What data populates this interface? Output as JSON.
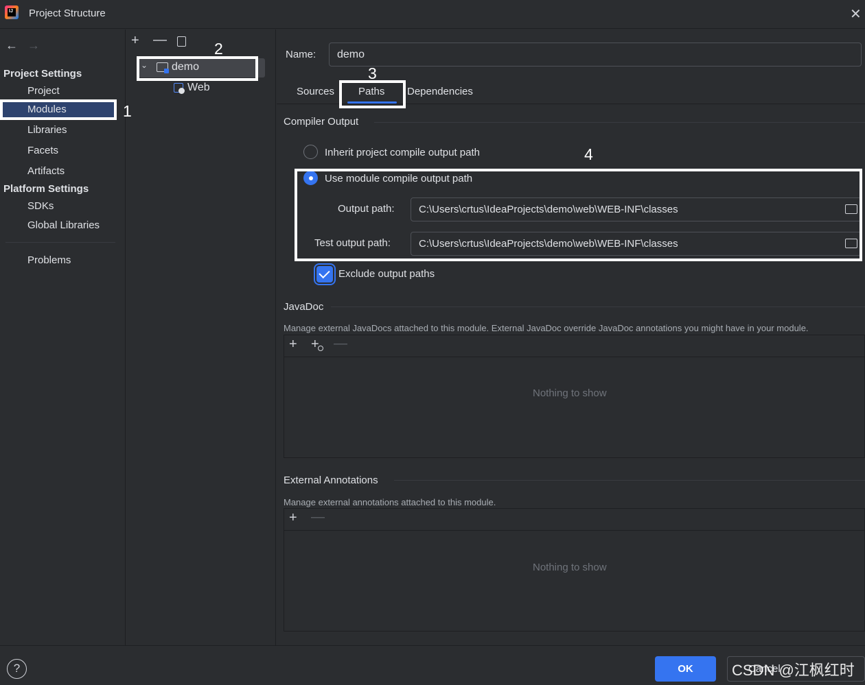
{
  "window": {
    "title": "Project Structure"
  },
  "sidebar": {
    "project_settings_header": "Project Settings",
    "items_project": [
      "Project",
      "Modules",
      "Libraries",
      "Facets",
      "Artifacts"
    ],
    "platform_settings_header": "Platform Settings",
    "items_platform": [
      "SDKs",
      "Global Libraries"
    ],
    "problems": "Problems",
    "selected": "Modules"
  },
  "tree": {
    "root": "demo",
    "child": "Web"
  },
  "module": {
    "name_label": "Name:",
    "name_value": "demo",
    "tabs": [
      "Sources",
      "Paths",
      "Dependencies"
    ],
    "active_tab": "Paths"
  },
  "compiler": {
    "title": "Compiler Output",
    "inherit_label": "Inherit project compile output path",
    "use_module_label": "Use module compile output path",
    "output_path_label": "Output path:",
    "output_path_value": "C:\\Users\\crtus\\IdeaProjects\\demo\\web\\WEB-INF\\classes",
    "test_output_path_label": "Test output path:",
    "test_output_path_value": "C:\\Users\\crtus\\IdeaProjects\\demo\\web\\WEB-INF\\classes",
    "exclude_label": "Exclude output paths",
    "exclude_checked": true
  },
  "javadoc": {
    "title": "JavaDoc",
    "description": "Manage external JavaDocs attached to this module. External JavaDoc override JavaDoc annotations you might have in your module.",
    "empty": "Nothing to show"
  },
  "annotations": {
    "title": "External Annotations",
    "description": "Manage external annotations attached to this module.",
    "empty": "Nothing to show"
  },
  "buttons": {
    "ok": "OK",
    "cancel": "Cancel"
  },
  "markers": [
    "1",
    "2",
    "3",
    "4"
  ],
  "watermark": "CSDN @江枫红时",
  "colors": {
    "accent": "#3574f0",
    "background": "#2b2d30",
    "selection": "#2e436e",
    "annotation": "#ffffff"
  }
}
